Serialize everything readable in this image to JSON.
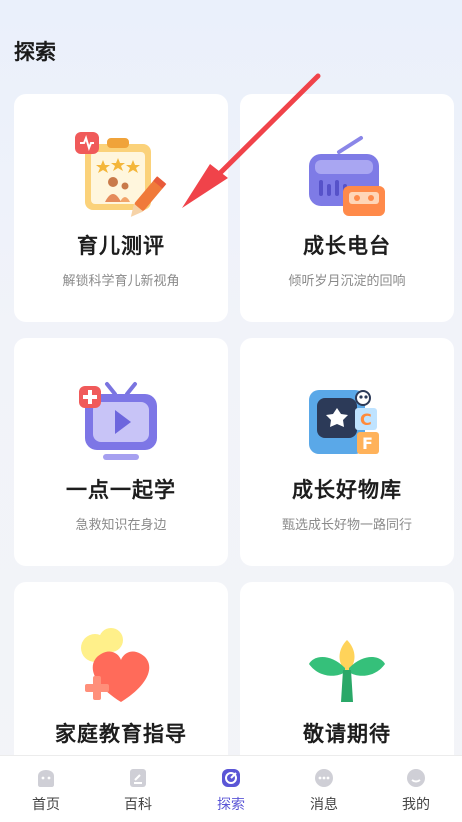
{
  "page": {
    "title": "探索"
  },
  "cards": [
    {
      "title": "育儿测评",
      "subtitle": "解锁科学育儿新视角",
      "icon": "clipboard-assessment-icon"
    },
    {
      "title": "成长电台",
      "subtitle": "倾听岁月沉淀的回响",
      "icon": "radio-icon"
    },
    {
      "title": "一点一起学",
      "subtitle": "急救知识在身边",
      "icon": "tv-play-icon"
    },
    {
      "title": "成长好物库",
      "subtitle": "甄选成长好物一路同行",
      "icon": "toy-box-icon"
    },
    {
      "title": "家庭教育指导",
      "subtitle": "",
      "icon": "heart-plus-icon"
    },
    {
      "title": "敬请期待",
      "subtitle": "",
      "icon": "sprout-icon"
    }
  ],
  "tabbar": {
    "active": "探索",
    "items": [
      {
        "label": "首页",
        "icon": "home-icon"
      },
      {
        "label": "百科",
        "icon": "encyclopedia-icon"
      },
      {
        "label": "探索",
        "icon": "explore-icon"
      },
      {
        "label": "消息",
        "icon": "chat-icon"
      },
      {
        "label": "我的",
        "icon": "profile-icon"
      }
    ]
  },
  "colors": {
    "accent": "#5b56d6",
    "arrow": "#f0434a"
  }
}
